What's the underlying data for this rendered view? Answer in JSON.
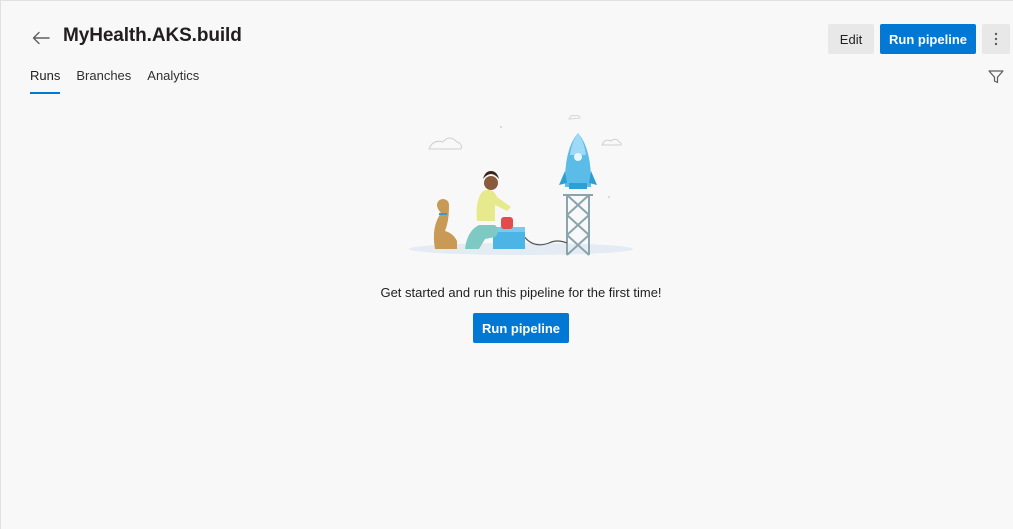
{
  "header": {
    "title": "MyHealth.AKS.build",
    "edit_label": "Edit",
    "run_pipeline_label": "Run pipeline"
  },
  "tabs": [
    {
      "label": "Runs",
      "active": true
    },
    {
      "label": "Branches",
      "active": false
    },
    {
      "label": "Analytics",
      "active": false
    }
  ],
  "empty_state": {
    "message": "Get started and run this pipeline for the first time!",
    "button_label": "Run pipeline"
  },
  "icons": {
    "back": "back-arrow-icon",
    "more": "more-vertical-icon",
    "filter": "filter-icon"
  },
  "colors": {
    "accent": "#0078d4",
    "background": "#f8f8f8",
    "secondary_button": "#e8e8e8"
  }
}
